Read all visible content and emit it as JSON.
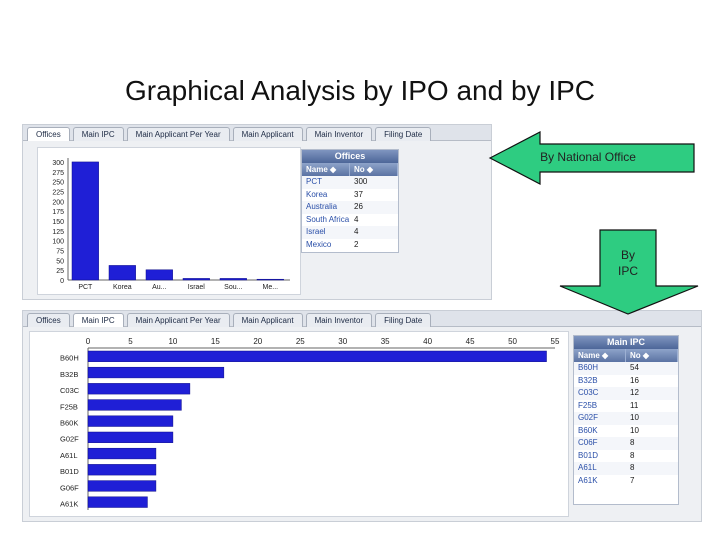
{
  "slide_title": "Graphical Analysis by IPO and by IPC",
  "colors": {
    "bar": "#1f1fd6",
    "arrow_fill": "#2ecc81",
    "table_header": "#5b73a3"
  },
  "top_panel": {
    "tabs": [
      "Offices",
      "Main IPC",
      "Main Applicant Per Year",
      "Main Applicant",
      "Main Inventor",
      "Filing Date"
    ],
    "active_tab": 0
  },
  "bottom_panel": {
    "tabs": [
      "Offices",
      "Main IPC",
      "Main Applicant Per Year",
      "Main Applicant",
      "Main Inventor",
      "Filing Date"
    ],
    "active_tab": 1
  },
  "offices_table": {
    "title": "Offices",
    "headers": [
      "Name ◆",
      "No ◆"
    ],
    "rows": [
      [
        "PCT",
        "300"
      ],
      [
        "Korea",
        "37"
      ],
      [
        "Australia",
        "26"
      ],
      [
        "South Africa",
        "4"
      ],
      [
        "Israel",
        "4"
      ],
      [
        "Mexico",
        "2"
      ]
    ]
  },
  "ipc_table": {
    "title": "Main IPC",
    "headers": [
      "Name ◆",
      "No ◆"
    ],
    "rows": [
      [
        "B60H",
        "54"
      ],
      [
        "B32B",
        "16"
      ],
      [
        "C03C",
        "12"
      ],
      [
        "F25B",
        "11"
      ],
      [
        "G02F",
        "10"
      ],
      [
        "B60K",
        "10"
      ],
      [
        "C06F",
        "8"
      ],
      [
        "B01D",
        "8"
      ],
      [
        "A61L",
        "8"
      ],
      [
        "A61K",
        "7"
      ]
    ]
  },
  "callouts": {
    "office": "By National Office",
    "ipc_line1": "By",
    "ipc_line2": "IPC"
  },
  "chart_data": [
    {
      "type": "bar",
      "categories": [
        "PCT",
        "Korea",
        "Au...",
        "Israel",
        "Sou...",
        "Me..."
      ],
      "values": [
        300,
        37,
        26,
        4,
        4,
        2
      ],
      "yticks": [
        0,
        25,
        50,
        75,
        100,
        125,
        150,
        175,
        200,
        225,
        250,
        275,
        300
      ],
      "ylim": [
        0,
        310
      ],
      "title": "",
      "xlabel": "",
      "ylabel": ""
    },
    {
      "type": "bar",
      "orientation": "horizontal",
      "categories": [
        "B60H",
        "B32B",
        "C03C",
        "F25B",
        "B60K",
        "G02F",
        "A61L",
        "B01D",
        "G06F",
        "A61K"
      ],
      "values": [
        54,
        16,
        12,
        11,
        10,
        10,
        8,
        8,
        8,
        7
      ],
      "xticks": [
        0,
        5,
        10,
        15,
        20,
        25,
        30,
        35,
        40,
        45,
        50,
        55
      ],
      "xlim": [
        0,
        55
      ],
      "title": "",
      "xlabel": "",
      "ylabel": ""
    }
  ]
}
